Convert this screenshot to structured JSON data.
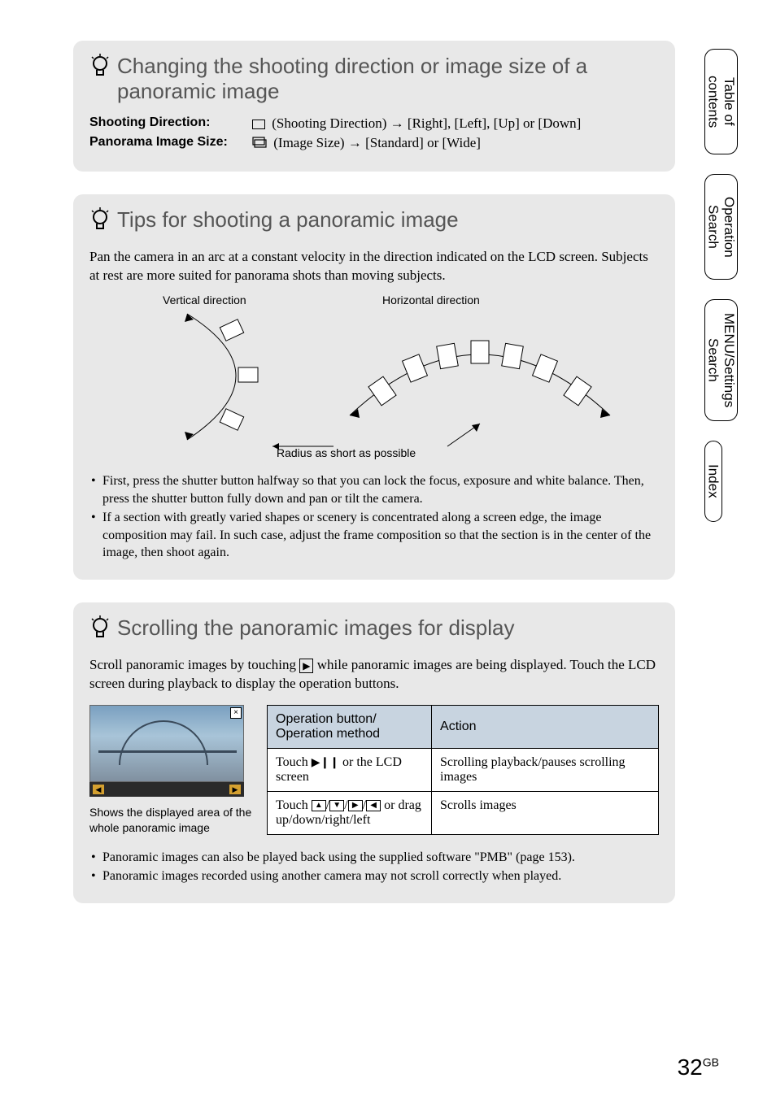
{
  "section1": {
    "title": "Changing the shooting direction or image size of a panoramic image",
    "row1_label": "Shooting Direction:",
    "row1_value_a": "(Shooting Direction)",
    "row1_value_b": "[Right], [Left], [Up] or [Down]",
    "row2_label": "Panorama Image Size:",
    "row2_value_a": "(Image Size)",
    "row2_value_b": "[Standard] or [Wide]"
  },
  "section2": {
    "title": "Tips for shooting a panoramic image",
    "intro": "Pan the camera in an arc at a constant velocity in the direction indicated on the LCD screen. Subjects at rest are more suited for panorama shots than moving subjects.",
    "label_vertical": "Vertical direction",
    "label_horizontal": "Horizontal direction",
    "label_radius": "Radius as short as possible",
    "bullet1": "First, press the shutter button halfway so that you can lock the focus, exposure and white balance. Then, press the shutter button fully down and pan or tilt the camera.",
    "bullet2": "If a section with greatly varied shapes or scenery is concentrated along a screen edge, the image composition may fail. In such case, adjust the frame composition so that the section is in the center of the image, then shoot again."
  },
  "section3": {
    "title": "Scrolling the panoramic images for display",
    "intro_a": "Scroll panoramic images by touching ",
    "intro_b": " while panoramic images are being displayed. Touch the LCD screen during playback to display the operation buttons.",
    "thumb_caption": "Shows the displayed area of the whole panoramic image",
    "th1": "Operation button/ Operation method",
    "th2": "Action",
    "r1c1_a": "Touch ",
    "r1c1_b": " or the LCD screen",
    "r1c2": "Scrolling playback/pauses scrolling images",
    "r2c1_a": "Touch ",
    "r2c1_b": " or drag up/down/right/left",
    "r2c2": "Scrolls images",
    "bullet1": "Panoramic images can also be played back using the supplied software \"PMB\" (page 153).",
    "bullet2": "Panoramic images recorded using another camera may not scroll correctly when played."
  },
  "sidetabs": {
    "t1": "Table of contents",
    "t2": "Operation Search",
    "t3": "MENU/Settings Search",
    "t4": "Index"
  },
  "page_number": "32",
  "page_suffix": "GB"
}
